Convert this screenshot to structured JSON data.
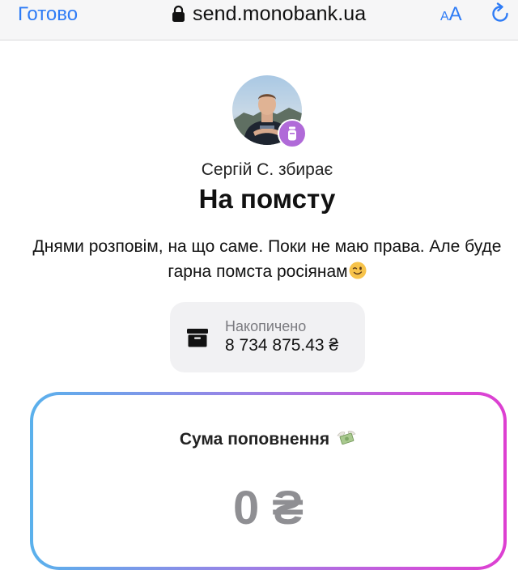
{
  "browser": {
    "done_label": "Готово",
    "url": "send.monobank.ua",
    "text_size_small": "A",
    "text_size_big": "A",
    "accent_color": "#2f7cf6"
  },
  "jar": {
    "collector_text": "Сергій С. збирає",
    "title": "На помсту",
    "description": "Днями розповім, на що саме. Поки не маю права. Але буде гарна помста росіянам",
    "description_emoji": "winking-face-emoji",
    "badge_icon": "jar-icon",
    "saved": {
      "label": "Накопичено",
      "amount": "8 734 875.43 ₴",
      "icon": "archive-box-icon"
    }
  },
  "topup": {
    "label": "Сума поповнення",
    "label_emoji": "money-with-wings-emoji",
    "amount": "0 ₴",
    "gradient_colors": [
      "#5ab1ec",
      "#9a82e6",
      "#d34fd9",
      "#dd3fd1"
    ]
  }
}
